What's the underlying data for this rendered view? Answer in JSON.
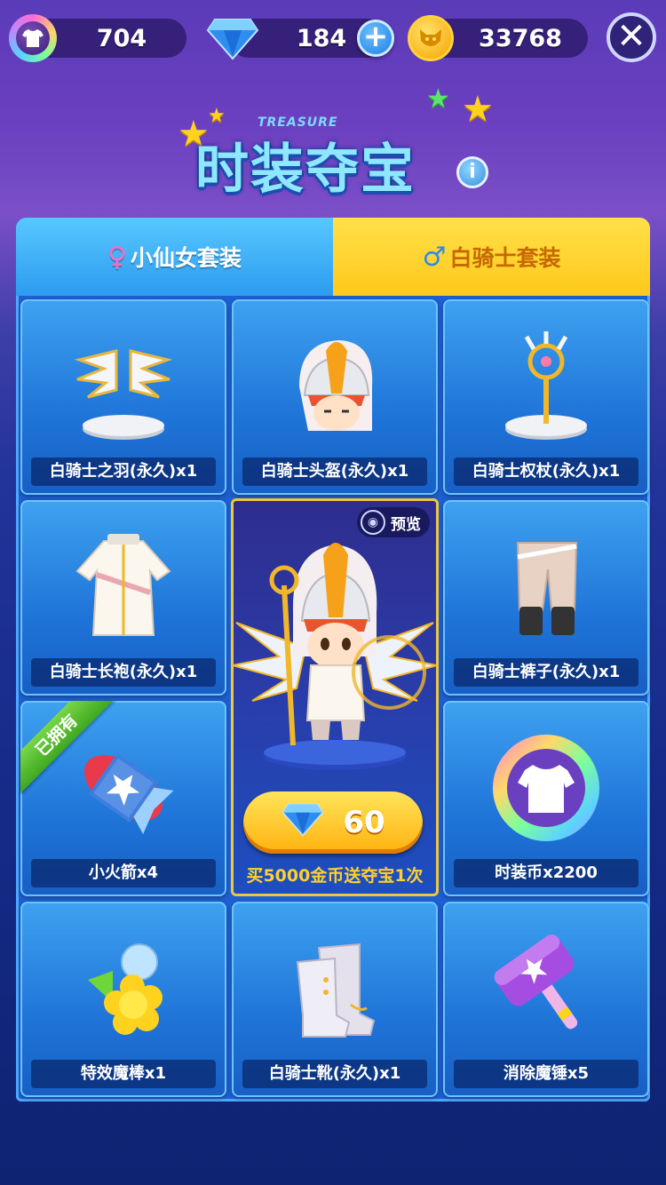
{
  "currency": {
    "fashion_coins": "704",
    "diamonds": "184",
    "gold": "33768"
  },
  "buttons": {
    "plus": "+",
    "close": "✕",
    "info": "i"
  },
  "title": {
    "sub": "TREASURE",
    "main": "时装夺宝"
  },
  "tabs": [
    {
      "symbol": "♀",
      "label": "小仙女套装",
      "active": true
    },
    {
      "symbol": "♂",
      "label": "白骑士套装",
      "active": false
    }
  ],
  "items": [
    {
      "label": "白骑士之羽(永久)x1",
      "icon": "wings-icon"
    },
    {
      "label": "白骑士头盔(永久)x1",
      "icon": "helmet-icon"
    },
    {
      "label": "白骑士权杖(永久)x1",
      "icon": "scepter-icon"
    },
    {
      "label": "白骑士长袍(永久)x1",
      "icon": "robe-icon"
    },
    {
      "label": "白骑士裤子(永久)x1",
      "icon": "pants-icon"
    },
    {
      "label": "小火箭x4",
      "icon": "rocket-icon",
      "owned_badge": "已拥有"
    },
    {
      "label": "时装币x2200",
      "icon": "fashion-coin-icon"
    },
    {
      "label": "特效魔棒x1",
      "icon": "magic-wand-icon"
    },
    {
      "label": "白骑士靴(永久)x1",
      "icon": "boots-icon"
    },
    {
      "label": "消除魔锤x5",
      "icon": "hammer-icon"
    }
  ],
  "feature": {
    "preview": "预览",
    "price": "60",
    "note": "买5000金币送夺宝1次",
    "icon": "knight-character-icon"
  },
  "colors": {
    "tab_active": "#2d9bef",
    "tab_inactive": "#ffc81b",
    "price_button": "#ffb20e",
    "note": "#ffcf2f"
  }
}
